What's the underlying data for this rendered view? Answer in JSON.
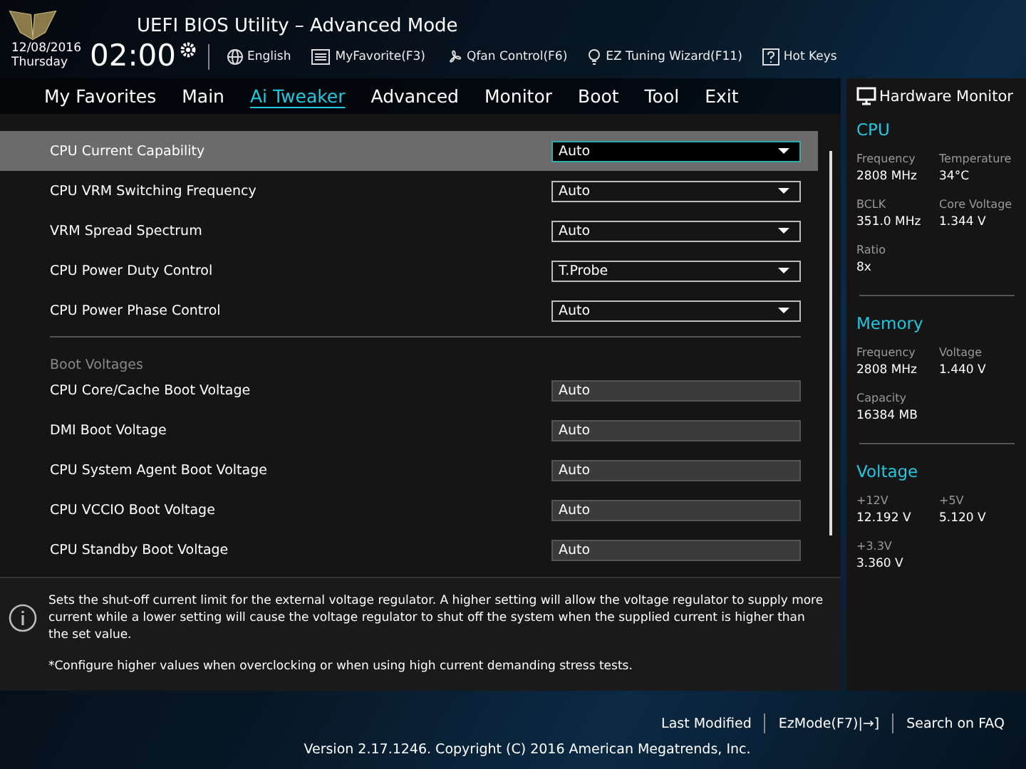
{
  "header": {
    "title": "UEFI BIOS Utility – Advanced Mode",
    "date": "12/08/2016",
    "day": "Thursday",
    "time": "02:00",
    "tools": [
      {
        "kind": "globe",
        "label": "English"
      },
      {
        "kind": "favorite",
        "label": "MyFavorite(F3)"
      },
      {
        "kind": "fan",
        "label": "Qfan Control(F6)"
      },
      {
        "kind": "bulb",
        "label": "EZ Tuning Wizard(F11)"
      },
      {
        "kind": "help",
        "label": "Hot Keys"
      }
    ]
  },
  "menu": [
    {
      "label": "My Favorites",
      "selected": false
    },
    {
      "label": "Main",
      "selected": false
    },
    {
      "label": "Ai Tweaker",
      "selected": true
    },
    {
      "label": "Advanced",
      "selected": false
    },
    {
      "label": "Monitor",
      "selected": false
    },
    {
      "label": "Boot",
      "selected": false
    },
    {
      "label": "Tool",
      "selected": false
    },
    {
      "label": "Exit",
      "selected": false
    }
  ],
  "settings": [
    {
      "kind": "dropdown",
      "label": "CPU Current Capability",
      "value": "Auto",
      "selected": true
    },
    {
      "kind": "dropdown",
      "label": "CPU VRM Switching Frequency",
      "value": "Auto",
      "selected": false
    },
    {
      "kind": "dropdown",
      "label": "VRM Spread Spectrum",
      "value": "Auto",
      "selected": false
    },
    {
      "kind": "dropdown",
      "label": "CPU Power Duty Control",
      "value": "T.Probe",
      "selected": false
    },
    {
      "kind": "dropdown",
      "label": "CPU Power Phase Control",
      "value": "Auto",
      "selected": false
    },
    {
      "kind": "section",
      "label": "Boot Voltages"
    },
    {
      "kind": "field",
      "label": "CPU Core/Cache Boot Voltage",
      "value": "Auto",
      "selected": false
    },
    {
      "kind": "field",
      "label": "DMI Boot Voltage",
      "value": "Auto",
      "selected": false
    },
    {
      "kind": "field",
      "label": "CPU System Agent Boot Voltage",
      "value": "Auto",
      "selected": false
    },
    {
      "kind": "field",
      "label": "CPU VCCIO Boot Voltage",
      "value": "Auto",
      "selected": false
    },
    {
      "kind": "field",
      "label": "CPU Standby Boot Voltage",
      "value": "Auto",
      "selected": false
    }
  ],
  "help": {
    "text": "Sets the shut-off current limit for the external voltage regulator. A higher setting will allow the voltage regulator to supply more current while a lower setting will cause the voltage regulator to shut off the system when the supplied current is higher than the set value.",
    "note": "*Configure higher values when overclocking or when using high current demanding stress tests."
  },
  "hardware_monitor": {
    "title": "Hardware Monitor",
    "sections": [
      {
        "title": "CPU",
        "items": [
          {
            "label": "Frequency",
            "value": "2808 MHz"
          },
          {
            "label": "Temperature",
            "value": "34°C"
          },
          {
            "label": "BCLK",
            "value": "351.0 MHz"
          },
          {
            "label": "Core Voltage",
            "value": "1.344 V"
          },
          {
            "label": "Ratio",
            "value": "8x"
          }
        ]
      },
      {
        "title": "Memory",
        "items": [
          {
            "label": "Frequency",
            "value": "2808 MHz"
          },
          {
            "label": "Voltage",
            "value": "1.440 V"
          },
          {
            "label": "Capacity",
            "value": "16384 MB"
          }
        ]
      },
      {
        "title": "Voltage",
        "items": [
          {
            "label": "+12V",
            "value": "12.192 V"
          },
          {
            "label": "+5V",
            "value": "5.120 V"
          },
          {
            "label": "+3.3V",
            "value": "3.360 V"
          }
        ]
      }
    ]
  },
  "footer": {
    "links": [
      "Last Modified",
      "EzMode(F7)|→]",
      "Search on FAQ"
    ],
    "copyright": "Version 2.17.1246. Copyright (C) 2016 American Megatrends, Inc."
  }
}
